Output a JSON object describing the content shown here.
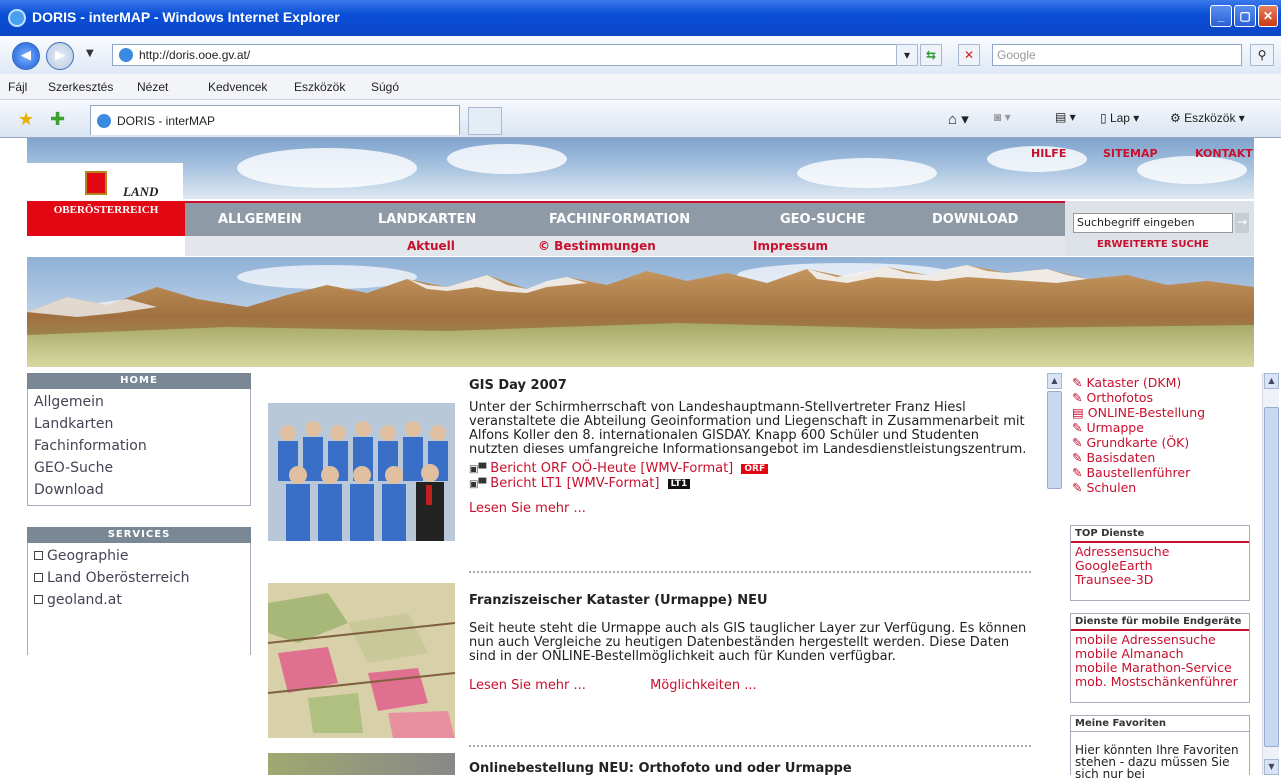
{
  "window": {
    "title": "DORIS - interMAP - Windows Internet Explorer",
    "min": "_",
    "max": "▢",
    "close": "✕"
  },
  "address": {
    "url": "http://doris.ooe.gv.at/",
    "search_placeholder": "Google"
  },
  "menu": [
    "Fájl",
    "Szerkesztés",
    "Nézet",
    "Kedvencek",
    "Eszközök",
    "Súgó"
  ],
  "tab": {
    "label": "DORIS - interMAP"
  },
  "toolbar": {
    "page": "Lap",
    "tools": "Eszközök"
  },
  "site": {
    "logo_text": "LAND",
    "region": "OBERÖSTERREICH",
    "top_links": [
      "HILFE",
      "SITEMAP",
      "KONTAKT"
    ],
    "nav": [
      "ALLGEMEIN",
      "LANDKARTEN",
      "FACHINFORMATION",
      "GEO-SUCHE",
      "DOWNLOAD"
    ],
    "subnav": [
      "Aktuell",
      "© Bestimmungen",
      "Impressum"
    ],
    "search_placeholder": "Suchbegriff eingeben",
    "search_link": "ERWEITERTE SUCHE"
  },
  "left": {
    "home_title": "HOME",
    "home_items": [
      "Allgemein",
      "Landkarten",
      "Fachinformation",
      "GEO-Suche",
      "Download"
    ],
    "services_title": "SERVICES",
    "services_items": [
      "Geographie",
      "Land Oberösterreich",
      "geoland.at"
    ]
  },
  "articles": [
    {
      "title": "GIS Day 2007",
      "text": "Unter der Schirmherrschaft von Landeshauptmann-Stellvertreter Franz Hiesl veranstaltete die Abteilung Geoinformation und Liegenschaft in Zusammenarbeit mit Alfons Koller den 8. internationalen GISDAY. Knapp 600 Schüler und Studenten nutzten dieses umfangreiche Informationsangebot im Landesdienstleistungszentrum.",
      "video1": "Bericht ORF OÖ-Heute [WMV-Format]",
      "badge1": "ORF",
      "video2": "Bericht LT1 [WMV-Format]",
      "badge2": "LT1",
      "more": "Lesen Sie mehr ..."
    },
    {
      "title": "Franziszeischer Kataster (Urmappe) NEU",
      "text": "Seit heute steht die Urmappe auch als GIS tauglicher Layer zur Verfügung. Es können nun auch Vergleiche zu heutigen Datenbeständen hergestellt werden. Diese Daten sind in der ONLINE-Bestellmöglichkeit auch für Kunden verfügbar.",
      "more": "Lesen Sie mehr ...",
      "more2": "Möglichkeiten ..."
    },
    {
      "title": "Onlinebestellung NEU: Orthofoto und oder Urmappe"
    }
  ],
  "right": {
    "links": [
      "Kataster (DKM)",
      "Orthofotos",
      "ONLINE-Bestellung",
      "Urmappe",
      "Grundkarte (ÖK)",
      "Basisdaten",
      "Baustellenführer",
      "Schulen"
    ],
    "top_title": "TOP Dienste",
    "top_items": [
      "Adressensuche",
      "GoogleEarth",
      "Traunsee-3D"
    ],
    "mobile_title": "Dienste für mobile Endgeräte",
    "mobile_items": [
      "mobile Adressensuche",
      "mobile Almanach",
      "mobile Marathon-Service",
      "mob. Mostschänkenführer"
    ],
    "fav_title": "Meine Favoriten",
    "fav_text": "Hier könnten Ihre Favoriten stehen - dazu müssen Sie sich nur bei"
  }
}
